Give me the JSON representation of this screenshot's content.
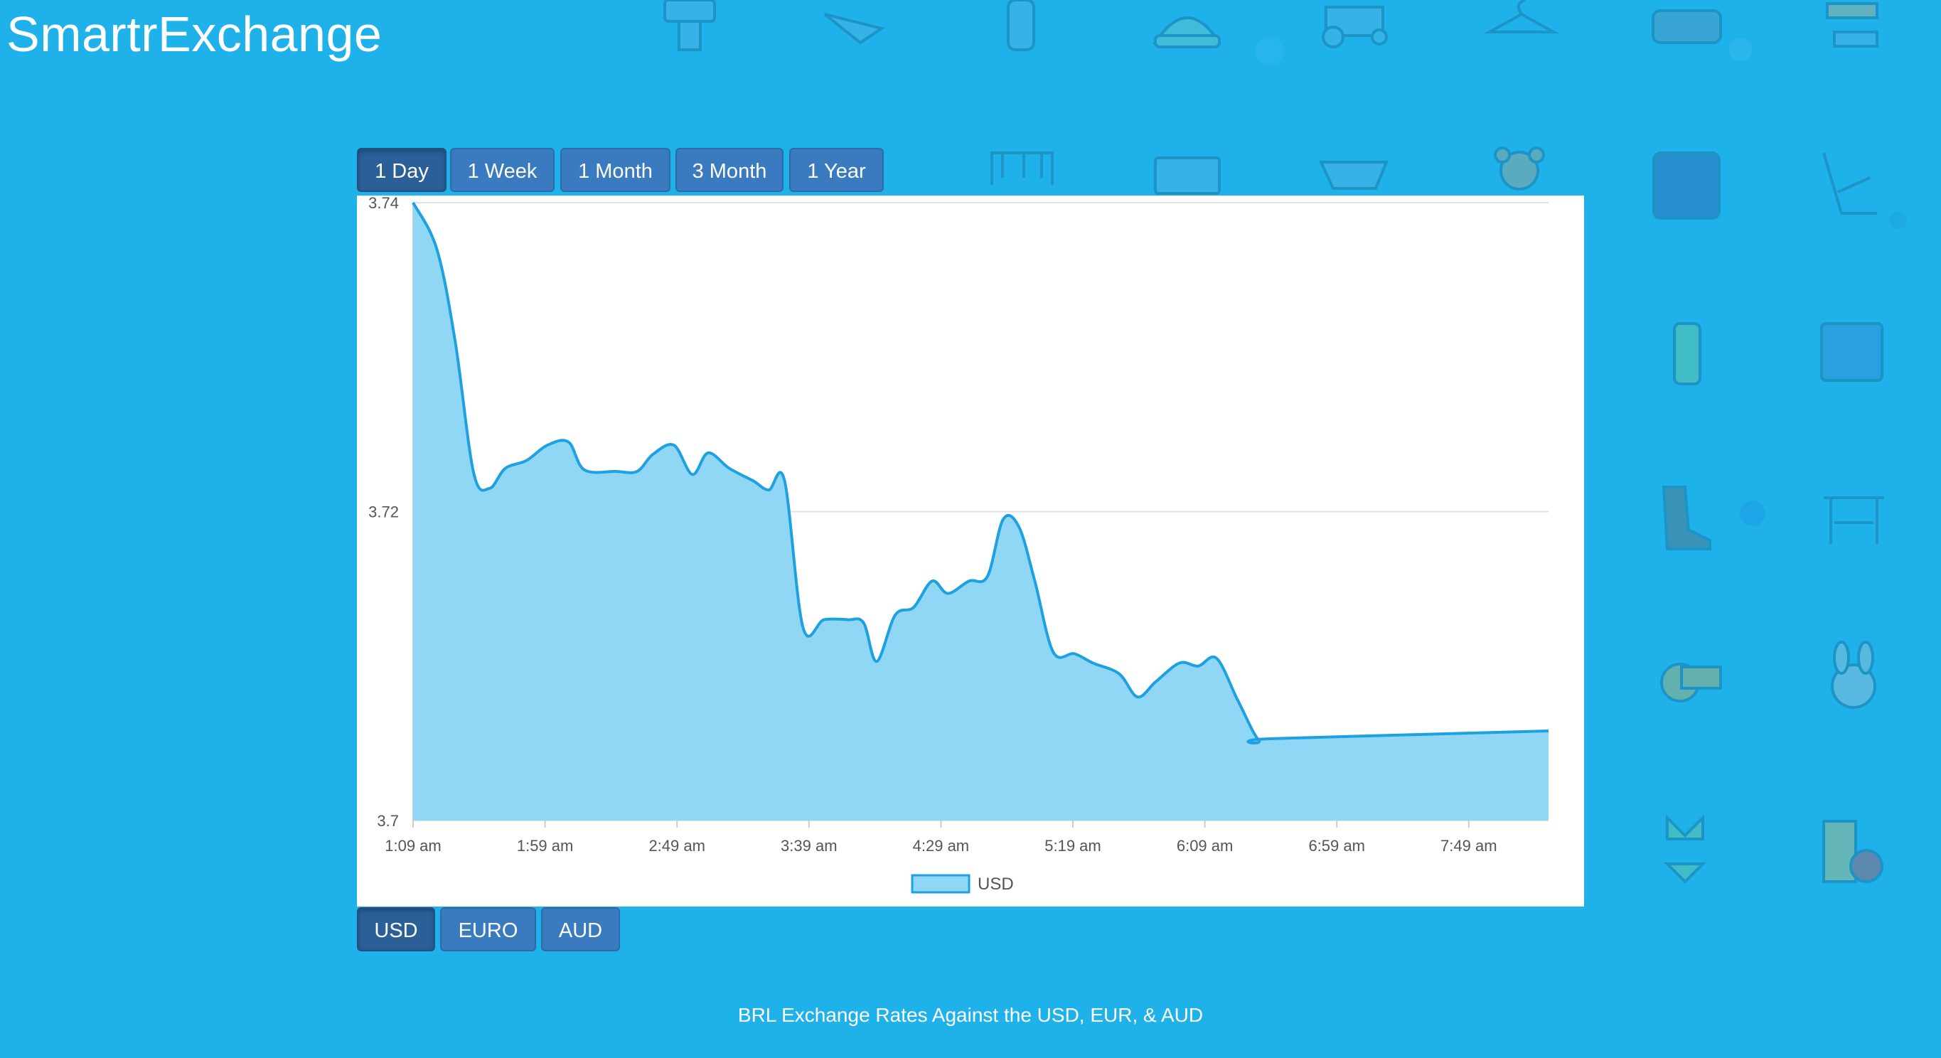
{
  "app": {
    "title": "SmartrExchange"
  },
  "range_tabs": [
    {
      "label": "1 Day",
      "active": true
    },
    {
      "label": "1 Week",
      "active": false
    },
    {
      "label": "1 Month",
      "active": false
    },
    {
      "label": "3 Month",
      "active": false
    },
    {
      "label": "1 Year",
      "active": false
    }
  ],
  "currency_tabs": [
    {
      "label": "USD",
      "active": true
    },
    {
      "label": "EURO",
      "active": false
    },
    {
      "label": "AUD",
      "active": false
    }
  ],
  "footer": {
    "text": "BRL Exchange Rates Against the USD, EUR, & AUD"
  },
  "background_icons": [
    "highchair-icon",
    "airplane-toy-icon",
    "bottle-icon",
    "beanie-icon",
    "tractor-toy-icon",
    "hanger-icon",
    "duffel-bag-icon",
    "stool-icon",
    "crib-icon",
    "pants-icon",
    "underwear-icon",
    "teddy-bear-icon",
    "yoga-mat-icon",
    "beach-chair-icon",
    "water-bottle-icon",
    "puzzle-icon",
    "boot-icon",
    "bench-press-icon",
    "tape-measure-icon",
    "bunny-plush-icon",
    "bikini-icon",
    "juice-apple-icon"
  ],
  "colors": {
    "background": "#1fb2ea",
    "line": "#1da1e0",
    "fill": "#8fd7f5",
    "button": "#3a7bc0",
    "button_active": "#2a5f98"
  },
  "chart_data": {
    "type": "area",
    "title": "",
    "xlabel": "",
    "ylabel": "",
    "ylim": [
      3.7,
      3.74
    ],
    "yticks": [
      "3.74",
      "3.72",
      "3.7"
    ],
    "xticks": [
      "1:09 am",
      "1:59 am",
      "2:49 am",
      "3:39 am",
      "4:29 am",
      "5:19 am",
      "6:09 am",
      "6:59 am",
      "7:49 am"
    ],
    "x_minutes_range": [
      69,
      500
    ],
    "legend": "bottom-center",
    "grid": true,
    "series": [
      {
        "name": "USD",
        "points": [
          [
            69,
            3.74
          ],
          [
            78,
            3.737
          ],
          [
            85,
            3.731
          ],
          [
            92,
            3.7225
          ],
          [
            98,
            3.7215
          ],
          [
            104,
            3.7228
          ],
          [
            112,
            3.7233
          ],
          [
            120,
            3.7243
          ],
          [
            128,
            3.7245
          ],
          [
            134,
            3.7227
          ],
          [
            146,
            3.7226
          ],
          [
            154,
            3.7226
          ],
          [
            160,
            3.7237
          ],
          [
            168,
            3.7243
          ],
          [
            175,
            3.7224
          ],
          [
            181,
            3.7238
          ],
          [
            189,
            3.7228
          ],
          [
            198,
            3.722
          ],
          [
            204,
            3.7214
          ],
          [
            210,
            3.722
          ],
          [
            217,
            3.7125
          ],
          [
            225,
            3.713
          ],
          [
            234,
            3.713
          ],
          [
            240,
            3.7128
          ],
          [
            245,
            3.7103
          ],
          [
            252,
            3.7133
          ],
          [
            259,
            3.7138
          ],
          [
            266,
            3.7155
          ],
          [
            272,
            3.7147
          ],
          [
            280,
            3.7155
          ],
          [
            287,
            3.7158
          ],
          [
            293,
            3.7195
          ],
          [
            299,
            3.719
          ],
          [
            305,
            3.7155
          ],
          [
            312,
            3.7109
          ],
          [
            320,
            3.7108
          ],
          [
            327,
            3.7102
          ],
          [
            337,
            3.7095
          ],
          [
            344,
            3.708
          ],
          [
            351,
            3.709
          ],
          [
            360,
            3.7102
          ],
          [
            367,
            3.71
          ],
          [
            374,
            3.7105
          ],
          [
            382,
            3.7078
          ],
          [
            390,
            3.7052
          ],
          [
            395,
            3.7053
          ],
          [
            500,
            3.7058
          ]
        ]
      }
    ]
  }
}
